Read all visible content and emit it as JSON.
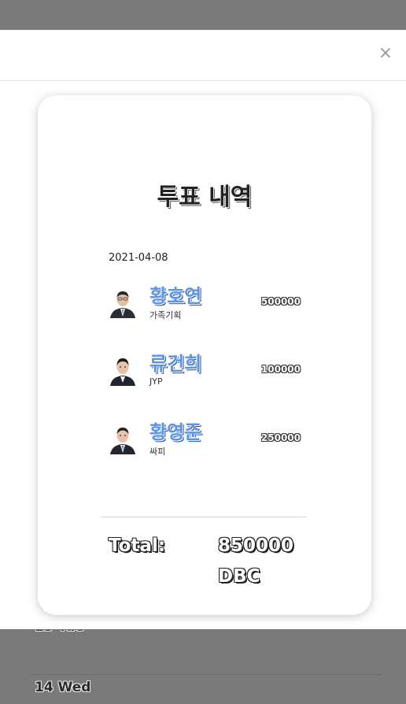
{
  "background": {
    "partial_date": "13 Tue",
    "date": "14 Wed"
  },
  "modal": {
    "close_glyph": "×",
    "card": {
      "title": "투표 내역",
      "date": "2021-04-08",
      "votes": [
        {
          "name": "황호연",
          "agency": "가족기획",
          "amount": "500000"
        },
        {
          "name": "류건희",
          "agency": "JYP",
          "amount": "100000"
        },
        {
          "name": "황영준",
          "agency": "싸피",
          "amount": "250000"
        }
      ],
      "total_label": "Total:",
      "total_value": "850000",
      "total_unit": "DBC"
    }
  },
  "colors": {
    "name_blue": "#5b93e6",
    "overlay": "#7a7a7a"
  }
}
